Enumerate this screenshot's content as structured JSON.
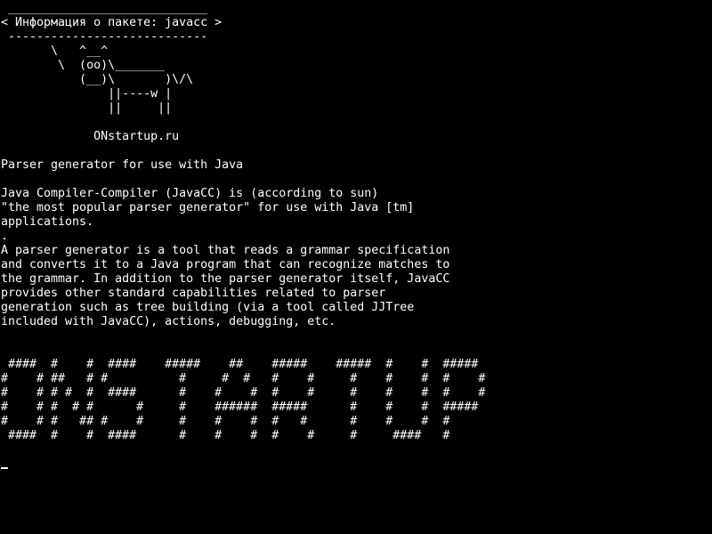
{
  "terminal": {
    "lines": [
      " ____________________________",
      "< Информация о пакете: javacc >",
      " ----------------------------",
      "       \\   ^__^",
      "        \\  (oo)\\_______",
      "           (__)\\       )\\/\\",
      "               ||----w |",
      "               ||     ||",
      "",
      "             ONstartup.ru",
      "",
      "Parser generator for use with Java",
      "",
      "Java Compiler-Compiler (JavaCC) is (according to sun)",
      "\"the most popular parser generator\" for use with Java [tm]",
      "applications.",
      ".",
      "A parser generator is a tool that reads a grammar specification",
      "and converts it to a Java program that can recognize matches to",
      "the grammar. In addition to the parser generator itself, JavaCC",
      "provides other standard capabilities related to parser",
      "generation such as tree building (via a tool called JJTree",
      "included with JavaCC), actions, debugging, etc.",
      "",
      "",
      " ####  #    #  ####    #####    ##    #####    #####  #    #  #####",
      "#    # ##   # #          #     #  #   #    #     #    #    #  #    #",
      "#    # # #  #  ####      #    #    #  #    #     #    #    #  #    #",
      "#    # #  # #      #     #    ######  #####      #    #    #  #####",
      "#    # #   ## #    #     #    #    #  #   #      #    #    #  #",
      " ####  #    #  ####      #    #    #  #    #     #     ####   #",
      ""
    ]
  }
}
